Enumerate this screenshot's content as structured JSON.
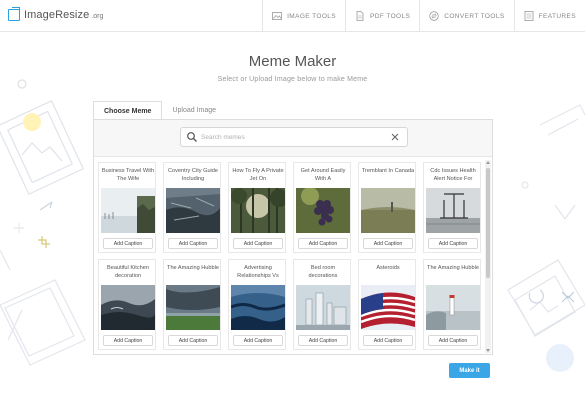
{
  "header": {
    "logo_text": "ImageResize",
    "logo_tld": ".org",
    "nav": [
      {
        "label": "IMAGE TOOLS",
        "icon": "image-icon"
      },
      {
        "label": "PDF TOOLS",
        "icon": "document-icon"
      },
      {
        "label": "CONVERT TOOLS",
        "icon": "convert-icon"
      },
      {
        "label": "FEATURES",
        "icon": "list-icon"
      }
    ]
  },
  "page": {
    "title": "Meme Maker",
    "subtitle": "Select or Upload Image below to make Meme"
  },
  "tabs": [
    {
      "label": "Choose Meme",
      "active": true
    },
    {
      "label": "Upload Image",
      "active": false
    }
  ],
  "search": {
    "placeholder": "Search memes",
    "value": ""
  },
  "memes": [
    {
      "title": "Business Travel With The Wife",
      "caption_btn": "Add Caption",
      "scene": "coast"
    },
    {
      "title": "Coventry City Guide Including",
      "caption_btn": "Add Caption",
      "scene": "rocks"
    },
    {
      "title": "How To Fly A Private Jet On",
      "caption_btn": "Add Caption",
      "scene": "forest"
    },
    {
      "title": "Get Around Easily With A",
      "caption_btn": "Add Caption",
      "scene": "grapes"
    },
    {
      "title": "Tremblant In Canada",
      "caption_btn": "Add Caption",
      "scene": "field"
    },
    {
      "title": "Cdc Issues Health Alert Notice For",
      "caption_btn": "Add Caption",
      "scene": "bw"
    },
    {
      "title": "Beautiful Kitchen decoration",
      "caption_btn": "Add Caption",
      "scene": "wave"
    },
    {
      "title": "The Amazing Hubble",
      "caption_btn": "Add Caption",
      "scene": "storm"
    },
    {
      "title": "Advertising Relationships Vs",
      "caption_btn": "Add Caption",
      "scene": "ocean"
    },
    {
      "title": "Bed room decorations",
      "caption_btn": "Add Caption",
      "scene": "factory"
    },
    {
      "title": "Asteroids",
      "caption_btn": "Add Caption",
      "scene": "flag"
    },
    {
      "title": "The Amazing Hubble",
      "caption_btn": "Add Caption",
      "scene": "lighthouse"
    }
  ],
  "actions": {
    "make_it": "Make it"
  },
  "colors": {
    "accent": "#3aa6e6",
    "logo": "#2ba3e0"
  }
}
